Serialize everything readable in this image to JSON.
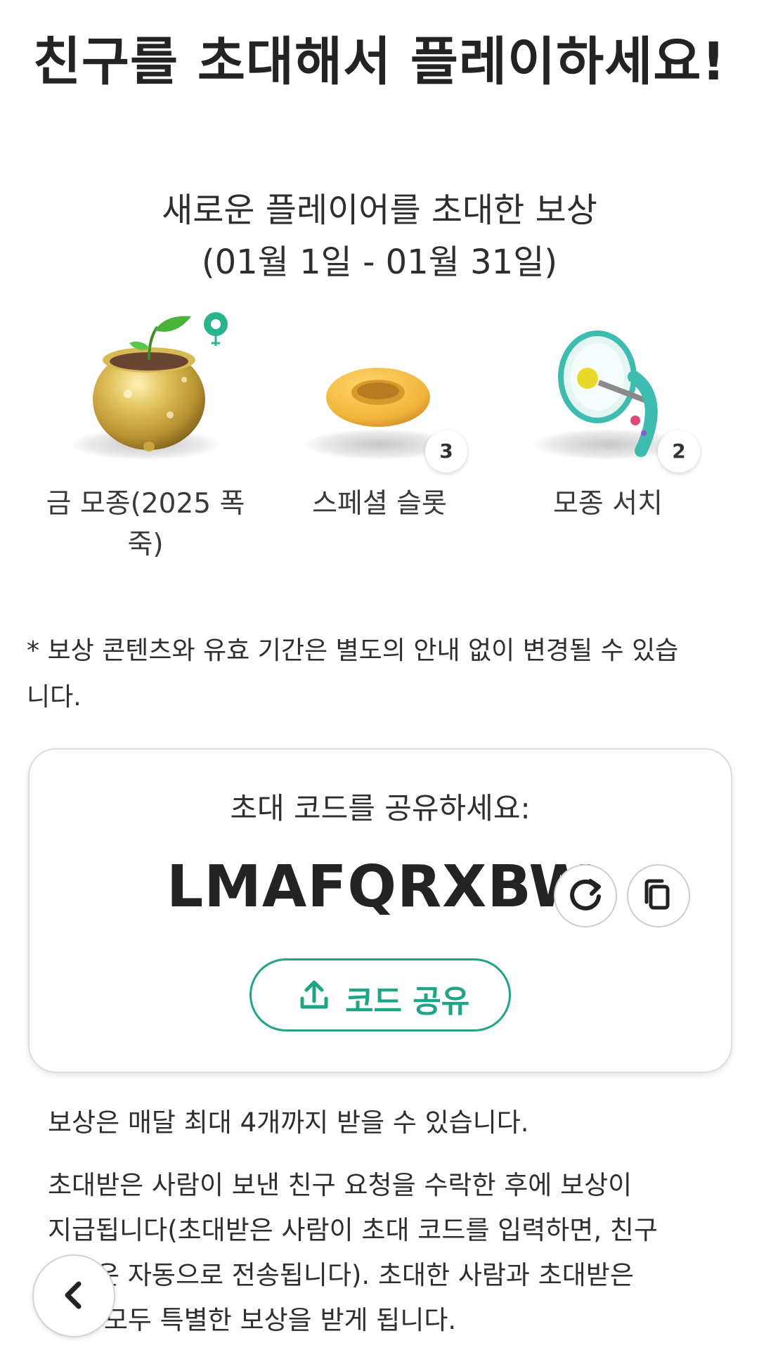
{
  "page": {
    "title": "친구를 초대해서 플레이하세요!",
    "reward_heading_line1": "새로운 플레이어를 초대한 보상",
    "reward_heading_line2": "(01월 1일 - 01월 31일)"
  },
  "rewards": [
    {
      "label": "금 모종(2025 폭죽)",
      "icon": "golden-seedling-pot-icon",
      "count": null
    },
    {
      "label": "스페셜 슬롯",
      "icon": "special-slot-icon",
      "count": "3"
    },
    {
      "label": "모종 서치",
      "icon": "seedling-search-icon",
      "count": "2"
    }
  ],
  "notice": "* 보상 콘텐츠와 유효 기간은 별도의 안내 없이 변경될 수 있습니다.",
  "invite_card": {
    "share_label": "초대 코드를 공유하세요:",
    "code": "LMAFQRXBW",
    "share_button_label": "코드 공유"
  },
  "info": {
    "monthly_limit": "보상은 매달 최대 4개까지 받을 수 있습니다.",
    "line1": "초대받은 사람이 보낸 친구 요청을 수락한 후에 보상이",
    "line2": "지급됩니다(초대받은 사람이 초대 코드를 입력하면, 친구",
    "line3": "요청은 자동으로 전송됩니다). 초대한 사람과 초대받은",
    "line4": "사람 모두 특별한 보상을 받게 됩니다."
  },
  "colors": {
    "accent": "#1ea586",
    "text": "#2e2e2e",
    "gold": "#c9a43c",
    "slot": "#f2b53a",
    "speaker": "#3fbcb0"
  }
}
